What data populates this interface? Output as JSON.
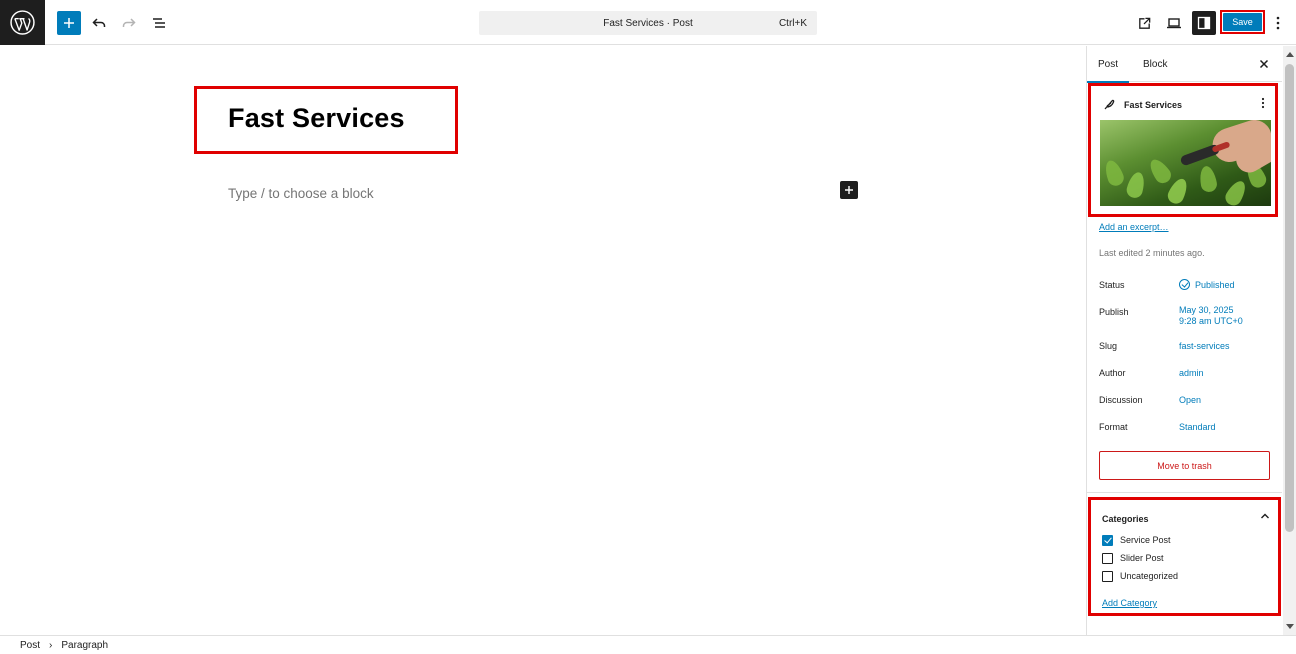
{
  "toolbar": {
    "document_title": "Fast Services · Post",
    "shortcut": "Ctrl+K",
    "save_label": "Save"
  },
  "editor": {
    "post_title": "Fast Services",
    "block_placeholder": "Type / to choose a block"
  },
  "breadcrumb": {
    "items": [
      "Post",
      "Paragraph"
    ]
  },
  "sidebar": {
    "tabs": [
      "Post",
      "Block"
    ],
    "summary": {
      "title": "Fast Services"
    },
    "excerpt_link": "Add an excerpt…",
    "last_edited": "Last edited 2 minutes ago.",
    "rows": {
      "status": {
        "label": "Status",
        "value": "Published"
      },
      "publish": {
        "label": "Publish",
        "value_line1": "May 30, 2025",
        "value_line2": "9:28 am UTC+0"
      },
      "slug": {
        "label": "Slug",
        "value": "fast-services"
      },
      "author": {
        "label": "Author",
        "value": "admin"
      },
      "discussion": {
        "label": "Discussion",
        "value": "Open"
      },
      "format": {
        "label": "Format",
        "value": "Standard"
      }
    },
    "trash_label": "Move to trash",
    "categories": {
      "title": "Categories",
      "items": [
        {
          "label": "Service Post",
          "checked": true
        },
        {
          "label": "Slider Post",
          "checked": false
        },
        {
          "label": "Uncategorized",
          "checked": false
        }
      ],
      "add_label": "Add Category"
    }
  },
  "colors": {
    "accent": "#007cba",
    "highlight": "#e00000",
    "danger": "#cc1818"
  }
}
